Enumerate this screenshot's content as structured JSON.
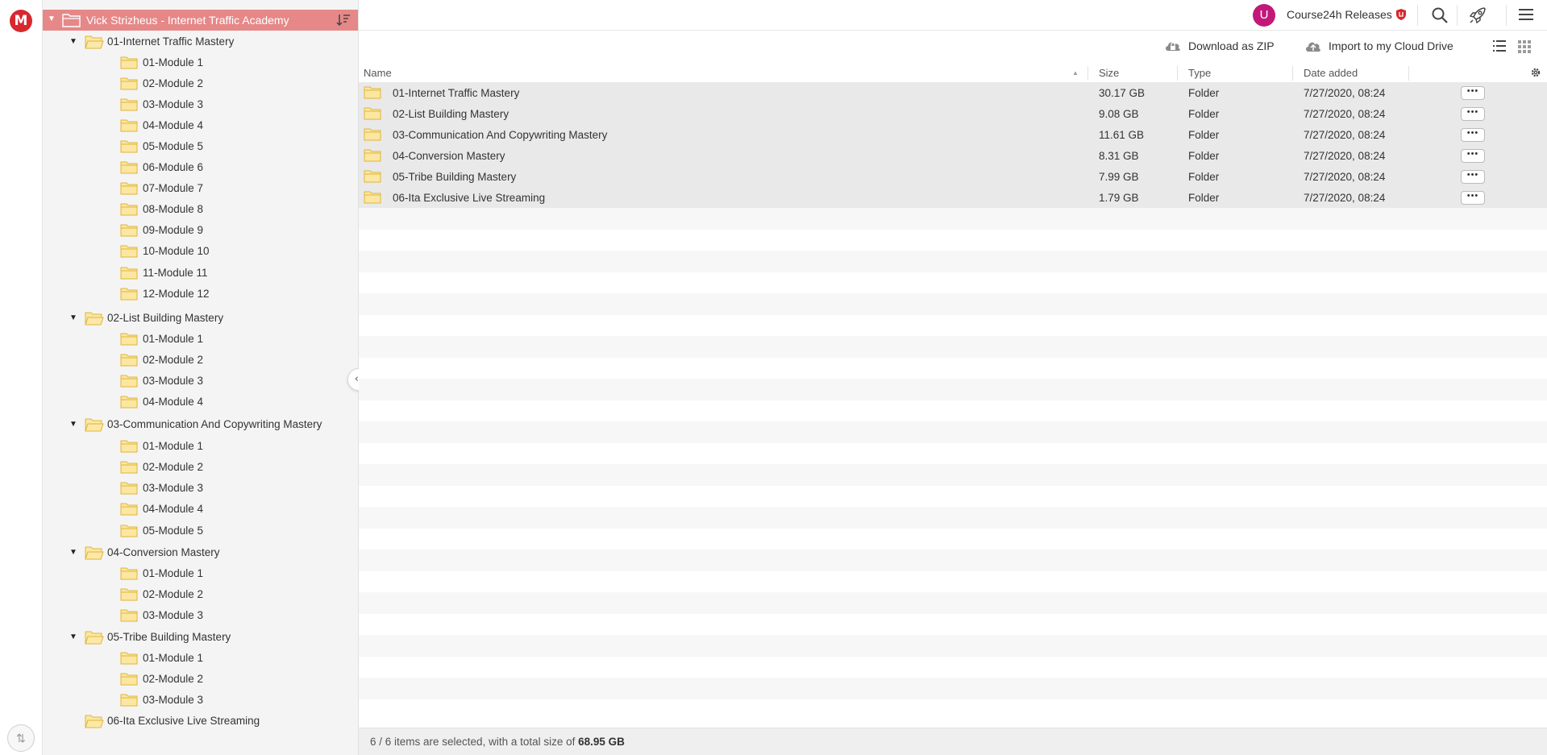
{
  "rail": {
    "logo_letter": "M"
  },
  "tree": {
    "root_label": "Vick Strizheus - Internet Traffic Academy",
    "nodes": [
      {
        "label": "01-Internet Traffic Mastery",
        "level": 1,
        "expanded": true
      },
      {
        "label": "01-Module 1",
        "level": 2
      },
      {
        "label": "02-Module 2",
        "level": 2
      },
      {
        "label": "03-Module 3",
        "level": 2
      },
      {
        "label": "04-Module 4",
        "level": 2
      },
      {
        "label": "05-Module 5",
        "level": 2
      },
      {
        "label": "06-Module 6",
        "level": 2
      },
      {
        "label": "07-Module 7",
        "level": 2
      },
      {
        "label": "08-Module 8",
        "level": 2
      },
      {
        "label": "09-Module 9",
        "level": 2
      },
      {
        "label": "10-Module 10",
        "level": 2
      },
      {
        "label": "11-Module 11",
        "level": 2
      },
      {
        "label": "12-Module 12",
        "level": 2
      },
      {
        "label": "02-List Building Mastery",
        "level": 1,
        "expanded": true
      },
      {
        "label": "01-Module 1",
        "level": 2
      },
      {
        "label": "02-Module 2",
        "level": 2
      },
      {
        "label": "03-Module 3",
        "level": 2
      },
      {
        "label": "04-Module 4",
        "level": 2
      },
      {
        "label": "03-Communication And Copywriting Mastery",
        "level": 1,
        "expanded": true
      },
      {
        "label": "01-Module 1",
        "level": 2
      },
      {
        "label": "02-Module 2",
        "level": 2
      },
      {
        "label": "03-Module 3",
        "level": 2
      },
      {
        "label": "04-Module 4",
        "level": 2
      },
      {
        "label": "05-Module 5",
        "level": 2
      },
      {
        "label": "04-Conversion Mastery",
        "level": 1,
        "expanded": true
      },
      {
        "label": "01-Module 1",
        "level": 2
      },
      {
        "label": "02-Module 2",
        "level": 2
      },
      {
        "label": "03-Module 3",
        "level": 2
      },
      {
        "label": "05-Tribe Building Mastery",
        "level": 1,
        "expanded": true
      },
      {
        "label": "01-Module 1",
        "level": 2
      },
      {
        "label": "02-Module 2",
        "level": 2
      },
      {
        "label": "03-Module 3",
        "level": 2
      },
      {
        "label": "06-Ita Exclusive Live Streaming",
        "level": 1,
        "expanded": false
      }
    ],
    "collapse_glyph": "‹‹"
  },
  "topbar": {
    "avatar_letter": "U",
    "account_name": "Course24h Releases"
  },
  "actions": {
    "download_zip": "Download as ZIP",
    "import_cloud": "Import to my Cloud Drive"
  },
  "table": {
    "headers": {
      "name": "Name",
      "size": "Size",
      "type": "Type",
      "date": "Date added"
    },
    "rows": [
      {
        "name": "01-Internet Traffic Mastery",
        "size": "30.17 GB",
        "type": "Folder",
        "date": "7/27/2020, 08:24"
      },
      {
        "name": "02-List Building Mastery",
        "size": "9.08 GB",
        "type": "Folder",
        "date": "7/27/2020, 08:24"
      },
      {
        "name": "03-Communication And Copywriting Mastery",
        "size": "11.61 GB",
        "type": "Folder",
        "date": "7/27/2020, 08:24"
      },
      {
        "name": "04-Conversion Mastery",
        "size": "8.31 GB",
        "type": "Folder",
        "date": "7/27/2020, 08:24"
      },
      {
        "name": "05-Tribe Building Mastery",
        "size": "7.99 GB",
        "type": "Folder",
        "date": "7/27/2020, 08:24"
      },
      {
        "name": "06-Ita Exclusive Live Streaming",
        "size": "1.79 GB",
        "type": "Folder",
        "date": "7/27/2020, 08:24"
      }
    ],
    "more_glyph": "•••"
  },
  "status": {
    "prefix": "6 / 6 items are selected, with a total size of ",
    "total": "68.95 GB"
  },
  "colors": {
    "brand": "#d9272e",
    "root_highlight": "#e68888",
    "folder": "#f7d774",
    "avatar": "#c2187a"
  }
}
